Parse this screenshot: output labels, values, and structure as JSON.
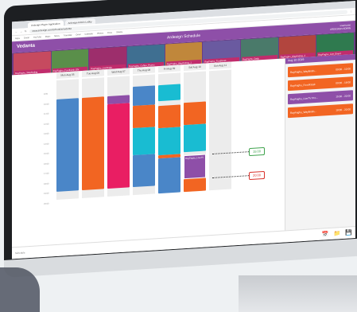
{
  "browser": {
    "tabs": [
      "Ardesign Player Application",
      "Ardesign Admin Lobby"
    ],
    "url": "www.ardesign.com/schedule/vedanta",
    "bookmarks": [
      "Apps",
      "Gmail",
      "YouTube",
      "Maps",
      "News",
      "Translate",
      "Drive",
      "Calendar",
      "Photos",
      "Docs",
      "Sheets"
    ]
  },
  "app": {
    "logo": "Vedanta",
    "title": "Ardesign Schedule",
    "user_line1": "username",
    "user_line2": "ARDESIGN ADMIN"
  },
  "thumbnails": [
    {
      "caption": "RayFaghu_Wayfinding",
      "color": "#c64a5f"
    },
    {
      "caption": "RayFaghu_Foodkiosk_EN",
      "color": "#5a8f4a"
    },
    {
      "caption": "RayFaghu_Livefinder",
      "color": "#9d2e6c"
    },
    {
      "caption": "RayFaghu_Coffee_Promo",
      "color": "#3f6f91"
    },
    {
      "caption": "RayFaghu_Wayfinding_1",
      "color": "#c0873b"
    },
    {
      "caption": "RayFaghu_Foodkiosk",
      "color": "#6a5aa0"
    },
    {
      "caption": "RayFaghu_Daily",
      "color": "#4a7a6a"
    },
    {
      "caption": "RayFaghu_Wayfinding_2",
      "color": "#b2453e"
    },
    {
      "caption": "RayFaghu_Live_Event",
      "color": "#2f7a4f"
    }
  ],
  "calendar": {
    "days": [
      "Mon Aug 05",
      "Tue Aug 06",
      "Wed Aug 07",
      "Thu Aug 08",
      "Fri Aug 09",
      "Sat Aug 10",
      "Sun Aug 11"
    ],
    "times": [
      "9:00",
      "10:00",
      "11:00",
      "12:00",
      "13:00",
      "14:00",
      "15:00",
      "16:00",
      "17:00",
      "18:00",
      "19:00",
      "20:00"
    ],
    "event_label": "RayFaghu_LiveTV",
    "marker_start": "15:00",
    "marker_end": "20:00"
  },
  "side": {
    "date": "Aug 10 2019",
    "items": [
      {
        "name": "RayFaghu_Wayfindin...",
        "time": "09:00 - 10:00",
        "color": "#f26522"
      },
      {
        "name": "RayFaghu_FoodKiosk",
        "time": "09:00 - 18:00",
        "color": "#f26522"
      },
      {
        "name": "RayFaghu_LiveTV Pro...",
        "time": "15:00 - 20:00",
        "color": "#8e4fa8"
      },
      {
        "name": "RayFaghu_Wayfindin...",
        "time": "18:00 - 20:00",
        "color": "#f26522"
      }
    ]
  },
  "footer": {
    "left": "Schedule"
  },
  "colors": {
    "blue": "#4a86c8",
    "orange": "#f26522",
    "pink": "#e91e63",
    "cyan": "#19bcd2",
    "purple": "#8e4fa8",
    "green": "#3fa34d",
    "red": "#d9322b"
  }
}
